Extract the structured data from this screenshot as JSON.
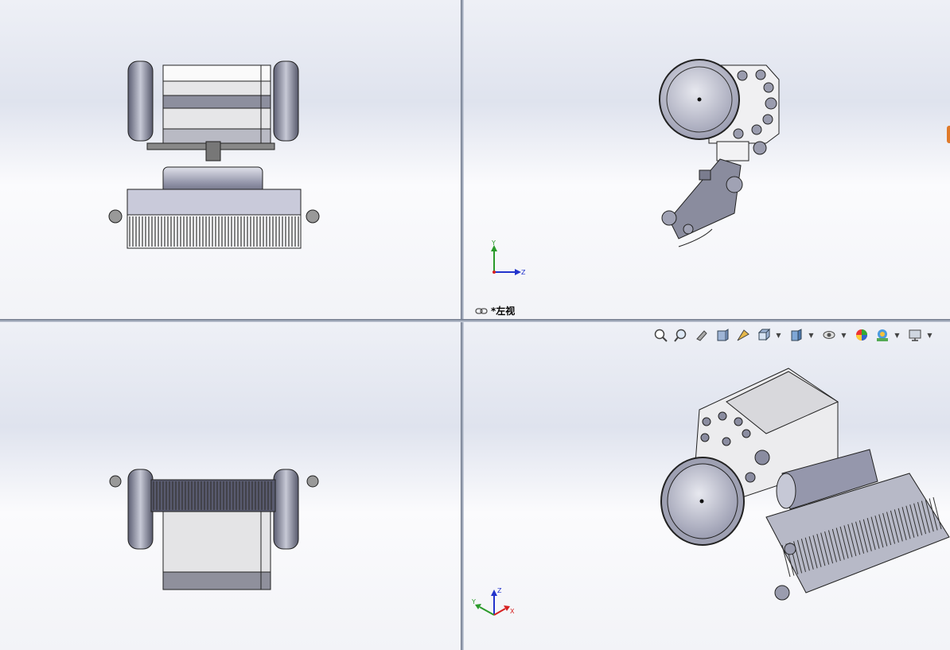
{
  "viewports": {
    "top_left": {
      "name": "front-view"
    },
    "top_right": {
      "name": "left-view",
      "label": "*左视"
    },
    "bottom_left": {
      "name": "top-view"
    },
    "bottom_right": {
      "name": "isometric-view"
    }
  },
  "triad": {
    "x": "X",
    "y": "Y",
    "z": "Z"
  },
  "heads_up_toolbar": {
    "buttons": [
      {
        "icon": "zoom-to-fit-icon"
      },
      {
        "icon": "zoom-to-area-icon"
      },
      {
        "icon": "previous-view-icon"
      },
      {
        "icon": "section-view-icon"
      },
      {
        "icon": "dynamic-annotation-icon"
      },
      {
        "icon": "view-orientation-icon",
        "dropdown": true
      },
      {
        "icon": "display-style-icon",
        "dropdown": true
      },
      {
        "icon": "hide-show-items-icon",
        "dropdown": true
      },
      {
        "icon": "edit-appearance-icon"
      },
      {
        "icon": "apply-scene-icon",
        "dropdown": true
      },
      {
        "icon": "view-settings-icon",
        "dropdown": true
      }
    ]
  },
  "colors": {
    "axis_x": "#d62020",
    "axis_y": "#2a9a2a",
    "axis_z": "#2233cc",
    "model_gray": "#9a9cae",
    "accent_orange": "#e07a2a"
  }
}
